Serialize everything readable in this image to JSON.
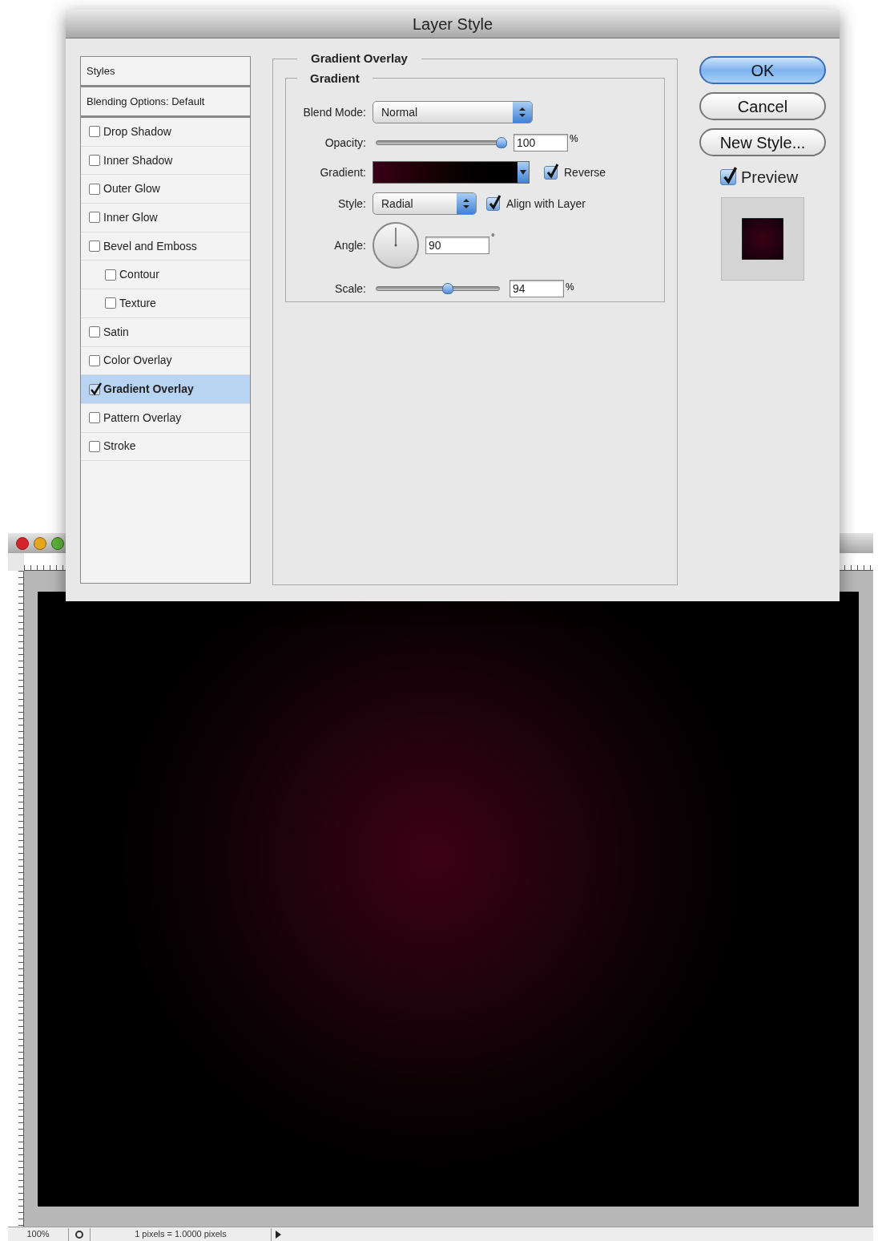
{
  "dialog": {
    "title": "Layer Style",
    "styles_list": [
      {
        "label": "Styles",
        "kind": "header",
        "selected": false
      },
      {
        "label": "Blending Options: Default",
        "kind": "header",
        "selected": false
      },
      {
        "label": "Drop Shadow",
        "kind": "check",
        "checked": false,
        "selected": false
      },
      {
        "label": "Inner Shadow",
        "kind": "check",
        "checked": false,
        "selected": false
      },
      {
        "label": "Outer Glow",
        "kind": "check",
        "checked": false,
        "selected": false
      },
      {
        "label": "Inner Glow",
        "kind": "check",
        "checked": false,
        "selected": false
      },
      {
        "label": "Bevel and Emboss",
        "kind": "check",
        "checked": false,
        "selected": false,
        "children": [
          {
            "label": "Contour",
            "kind": "check",
            "checked": false,
            "selected": false
          },
          {
            "label": "Texture",
            "kind": "check",
            "checked": false,
            "selected": false
          }
        ]
      },
      {
        "label": "Satin",
        "kind": "check",
        "checked": false,
        "selected": false
      },
      {
        "label": "Color Overlay",
        "kind": "check",
        "checked": false,
        "selected": false
      },
      {
        "label": "Gradient Overlay",
        "kind": "check",
        "checked": true,
        "selected": true
      },
      {
        "label": "Pattern Overlay",
        "kind": "check",
        "checked": false,
        "selected": false
      },
      {
        "label": "Stroke",
        "kind": "check",
        "checked": false,
        "selected": false
      }
    ],
    "section_title": "Gradient Overlay",
    "group_title": "Gradient",
    "blend_mode": {
      "label": "Blend Mode:",
      "value": "Normal"
    },
    "opacity": {
      "label": "Opacity:",
      "level": 0.98,
      "value": "100",
      "unit": "%"
    },
    "gradient": {
      "label": "Gradient:"
    },
    "reverse": {
      "label": "Reverse",
      "checked": true
    },
    "style": {
      "label": "Style:",
      "value": "Radial"
    },
    "align_with_layer": {
      "label": "Align with Layer",
      "checked": true
    },
    "angle": {
      "label": "Angle:",
      "value": "90",
      "unit": "°"
    },
    "scale": {
      "label": "Scale:",
      "level": 0.58,
      "value": "94",
      "unit": "%"
    },
    "buttons": [
      {
        "label": "OK",
        "default": true
      },
      {
        "label": "Cancel",
        "default": false
      },
      {
        "label": "New Style...",
        "default": false
      }
    ],
    "preview": {
      "label": "Preview",
      "checked": true
    }
  },
  "document": {
    "status_bar": {
      "zoom": "100%",
      "info": "1 pixels = 1.0000 pixels"
    }
  }
}
